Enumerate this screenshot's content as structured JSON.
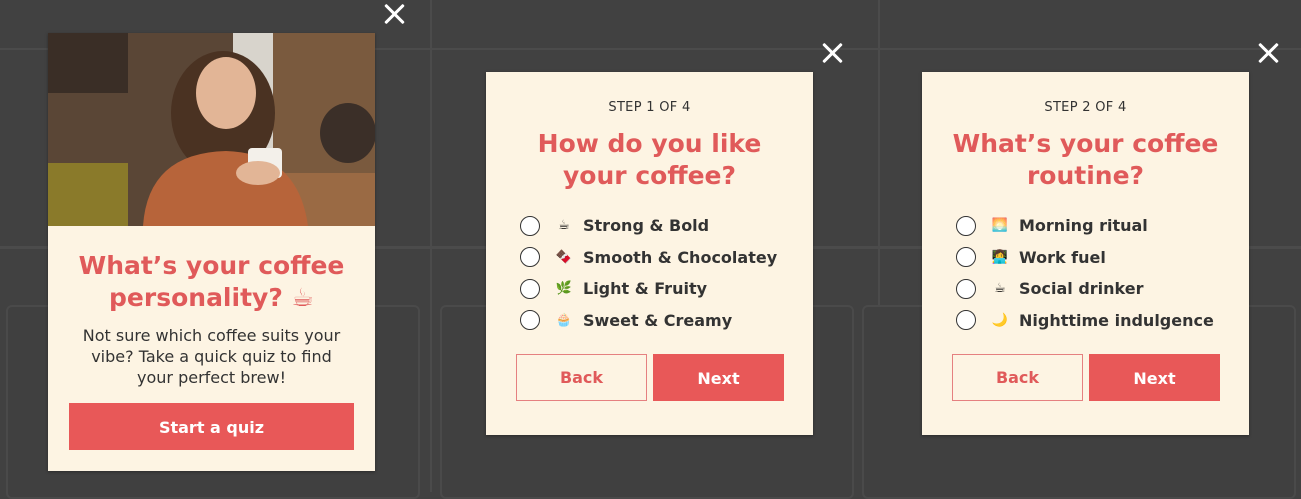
{
  "colors": {
    "accent": "#e85858",
    "card_bg": "#fdf4e3",
    "overlay": "#414141"
  },
  "intro": {
    "title_line1": "What’s your coffee",
    "title_line2": "personality? ☕",
    "description": "Not sure which coffee suits your vibe? Take a quick quiz to find your perfect brew!",
    "start_label": "Start a quiz",
    "image_alt": "woman holding coffee cup"
  },
  "step1": {
    "step": "STEP 1 OF 4",
    "title_line1": "How do you like",
    "title_line2": "your coffee?",
    "options": [
      {
        "emoji": "☕",
        "label": "Strong & Bold"
      },
      {
        "emoji": "🍫",
        "label": "Smooth & Chocolatey"
      },
      {
        "emoji": "🌿",
        "label": "Light & Fruity"
      },
      {
        "emoji": "🧁",
        "label": "Sweet & Creamy"
      }
    ],
    "back_label": "Back",
    "next_label": "Next"
  },
  "step2": {
    "step": "STEP 2 OF 4",
    "title_line1": "What’s your coffee",
    "title_line2": "routine?",
    "options": [
      {
        "emoji": "🌅",
        "label": "Morning ritual"
      },
      {
        "emoji": "👩‍💻",
        "label": "Work fuel"
      },
      {
        "emoji": "☕",
        "label": "Social drinker"
      },
      {
        "emoji": "🌙",
        "label": "Nighttime indulgence"
      }
    ],
    "back_label": "Back",
    "next_label": "Next"
  }
}
